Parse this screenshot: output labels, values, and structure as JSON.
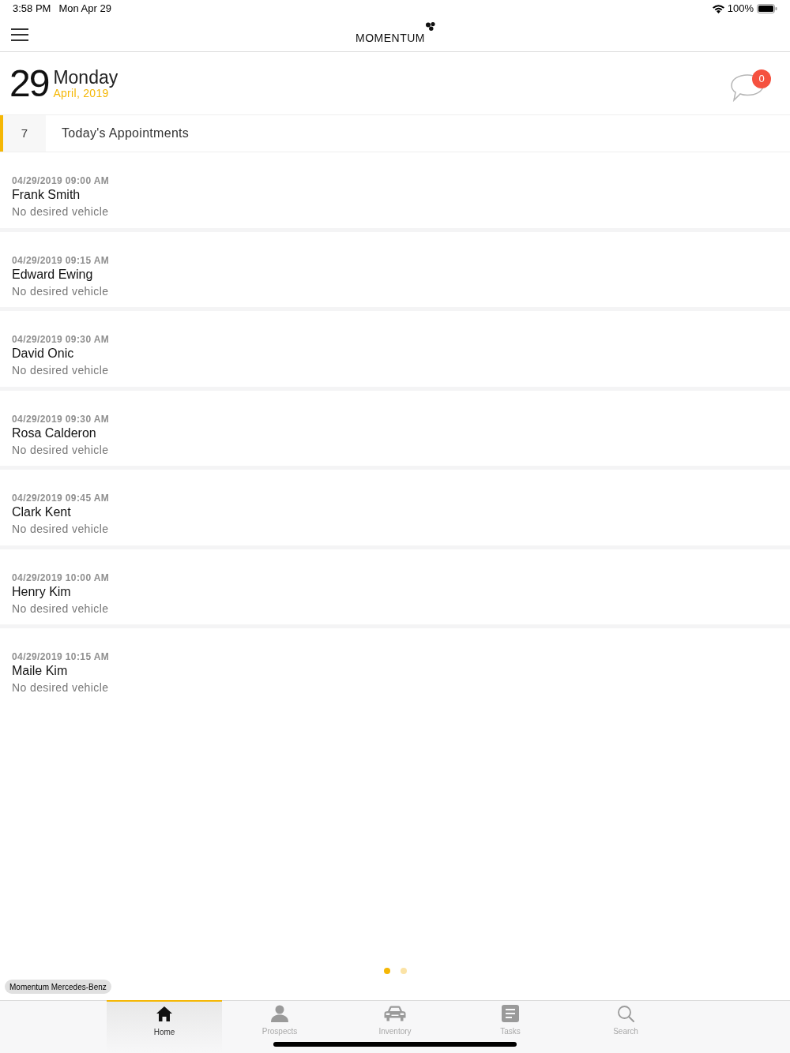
{
  "status_bar": {
    "time": "3:58 PM",
    "date": "Mon Apr 29",
    "battery": "100%"
  },
  "header": {
    "logo": "MOMENTUM"
  },
  "date": {
    "day": "29",
    "weekday": "Monday",
    "month_year": "April, 2019",
    "message_count": "0"
  },
  "summary": {
    "count": "7",
    "label": "Today's Appointments"
  },
  "appointments": [
    {
      "datetime": "04/29/2019 09:00 AM",
      "name": "Frank Smith",
      "vehicle": "No desired vehicle"
    },
    {
      "datetime": "04/29/2019 09:15 AM",
      "name": "Edward Ewing",
      "vehicle": "No desired vehicle"
    },
    {
      "datetime": "04/29/2019 09:30 AM",
      "name": "David Onic",
      "vehicle": "No desired vehicle"
    },
    {
      "datetime": "04/29/2019 09:30 AM",
      "name": "Rosa Calderon",
      "vehicle": "No desired vehicle"
    },
    {
      "datetime": "04/29/2019 09:45 AM",
      "name": "Clark Kent",
      "vehicle": "No desired vehicle"
    },
    {
      "datetime": "04/29/2019 10:00 AM",
      "name": "Henry Kim",
      "vehicle": "No desired vehicle"
    },
    {
      "datetime": "04/29/2019 10:15 AM",
      "name": "Maile Kim",
      "vehicle": "No desired vehicle"
    }
  ],
  "pager": [
    {
      "selected": true
    },
    {
      "selected": false
    }
  ],
  "dealer": "Momentum Mercedes-Benz",
  "tabs": [
    {
      "label": "Home",
      "selected": true
    },
    {
      "label": "Prospects",
      "selected": false
    },
    {
      "label": "Inventory",
      "selected": false
    },
    {
      "label": "Tasks",
      "selected": false
    },
    {
      "label": "Search",
      "selected": false
    }
  ]
}
